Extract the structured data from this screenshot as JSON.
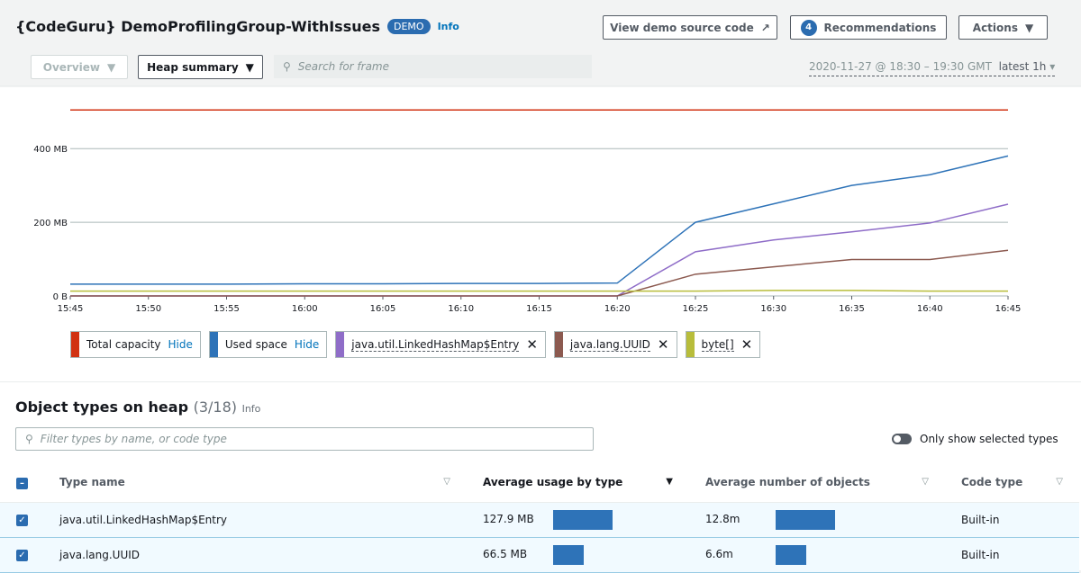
{
  "header": {
    "title": "{CodeGuru} DemoProfilingGroup-WithIssues",
    "badge": "DEMO",
    "info": "Info",
    "view_source": "View demo source code",
    "rec_count": "4",
    "recommendations": "Recommendations",
    "actions": "Actions",
    "overview": "Overview",
    "heap_summary": "Heap summary",
    "search_placeholder": "Search for frame",
    "date_range": "2020-11-27 @ 18:30 – 19:30 GMT",
    "latest": "latest 1h"
  },
  "chart_data": {
    "type": "line",
    "x": [
      "15:45",
      "15:50",
      "15:55",
      "16:00",
      "16:05",
      "16:10",
      "16:15",
      "16:20",
      "16:25",
      "16:30",
      "16:35",
      "16:40",
      "16:45"
    ],
    "yticks": [
      "0 B",
      "200 MB",
      "400 MB"
    ],
    "ylim": [
      0,
      520
    ],
    "grid": true,
    "series": [
      {
        "name": "Total capacity",
        "color": "#d13212",
        "values": [
          505,
          505,
          505,
          505,
          505,
          505,
          505,
          505,
          505,
          505,
          505,
          505,
          505
        ]
      },
      {
        "name": "Used space",
        "color": "#2e73b8",
        "values": [
          32,
          32,
          32,
          33,
          33,
          34,
          34,
          35,
          200,
          250,
          300,
          329,
          380
        ]
      },
      {
        "name": "java.util.LinkedHashMap$Entry",
        "color": "#8f6dc8",
        "values": [
          0,
          0,
          0,
          0,
          0,
          0,
          0,
          0,
          120,
          152,
          174,
          198,
          249
        ]
      },
      {
        "name": "java.lang.UUID",
        "color": "#8c5a50",
        "values": [
          0,
          0,
          0,
          0,
          0,
          0,
          0,
          0,
          59,
          79,
          99,
          99,
          124
        ]
      },
      {
        "name": "byte[]",
        "color": "#b8bd3b",
        "values": [
          13,
          13,
          13,
          13,
          13,
          13,
          13,
          13,
          13,
          15,
          15,
          13,
          13
        ]
      }
    ]
  },
  "legend": {
    "hide": "Hide"
  },
  "section": {
    "title": "Object types on heap",
    "count": "(3/18)",
    "info": "Info",
    "filter_placeholder": "Filter types by name, or code type",
    "toggle": "Only show selected types"
  },
  "table": {
    "headers": [
      "Type name",
      "Average usage by type",
      "Average number of objects",
      "Code type"
    ],
    "rows": [
      {
        "name": "java.util.LinkedHashMap$Entry",
        "usage": "127.9 MB",
        "usage_pct": 100,
        "objects": "12.8m",
        "objects_pct": 100,
        "code": "Built-in"
      },
      {
        "name": "java.lang.UUID",
        "usage": "66.5 MB",
        "usage_pct": 52,
        "objects": "6.6m",
        "objects_pct": 52,
        "code": "Built-in"
      }
    ]
  }
}
